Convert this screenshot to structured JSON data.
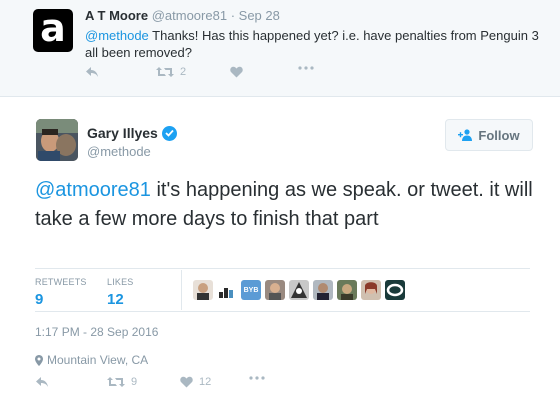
{
  "reply": {
    "avatar_letter": "a",
    "name": "A T Moore",
    "handle": "@atmoore81",
    "separator": "·",
    "date": "Sep 28",
    "mention": "@methode",
    "text": " Thanks!  Has this happened yet? i.e. have penalties from Penguin 3 all been removed?",
    "retweet_count": "2"
  },
  "tweet": {
    "author_name": "Gary Illyes",
    "author_handle": "@methode",
    "follow_label": "Follow",
    "mention": "@atmoore81",
    "text": " it's happening as we speak. or tweet. it will take a few more days to finish that part",
    "stats": {
      "retweets_label": "RETWEETS",
      "retweets": "9",
      "likes_label": "LIKES",
      "likes": "12"
    },
    "timestamp": "1:17 PM - 28 Sep 2016",
    "location": "Mountain View, CA",
    "action_retweets": "9",
    "action_likes": "12",
    "liker_byb": "BYB"
  },
  "colors": {
    "link": "#1b95e0",
    "verified": "#1da1f2",
    "muted": "#8899a6",
    "action": "#aab8c2"
  }
}
